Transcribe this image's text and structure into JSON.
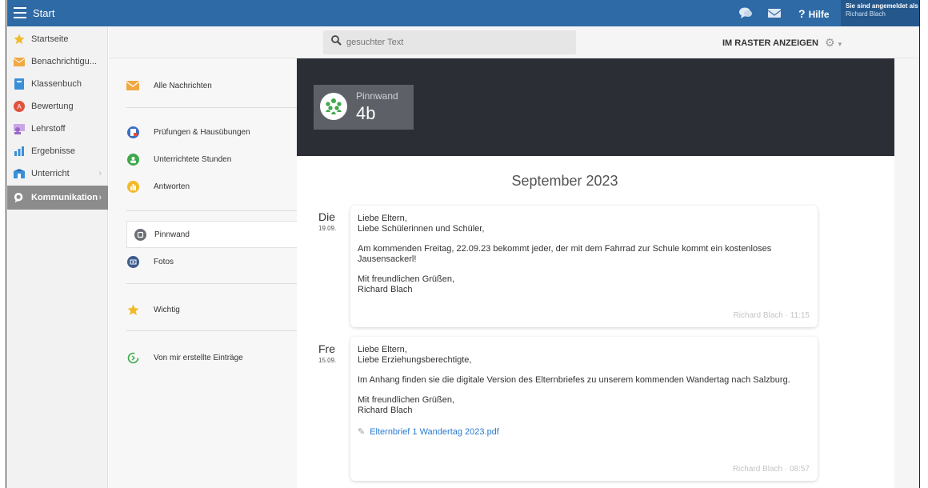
{
  "topbar": {
    "title": "Start",
    "help_label": "Hilfe",
    "login_line1": "Sie sind angemeldet als",
    "login_line2": "Richard Blach"
  },
  "sidebar": {
    "items": [
      {
        "label": "Startseite",
        "icon": "star-icon",
        "color": "#f2b92a"
      },
      {
        "label": "Benachrichtigu...",
        "icon": "mail-icon",
        "color": "#f0a843"
      },
      {
        "label": "Klassenbuch",
        "icon": "book-icon",
        "color": "#3a8fd9"
      },
      {
        "label": "Bewertung",
        "icon": "rating-icon",
        "color": "#e0533d"
      },
      {
        "label": "Lehrstoff",
        "icon": "teacher-icon",
        "color": "#9b67c9"
      },
      {
        "label": "Ergebnisse",
        "icon": "chart-icon",
        "color": "#3a8fd9"
      },
      {
        "label": "Unterricht",
        "icon": "school-icon",
        "color": "#3a8fd9"
      },
      {
        "label": "Kommunikation",
        "icon": "chat-icon",
        "color": "#ffffff"
      }
    ]
  },
  "toolbar": {
    "search_placeholder": "gesuchter Text",
    "raster_label": "IM RASTER ANZEIGEN"
  },
  "subnav": {
    "items": [
      {
        "label": "Alle Nachrichten",
        "icon": "envelope-icon"
      },
      {
        "label": "Prüfungen & Hausübungen",
        "icon": "exam-icon"
      },
      {
        "label": "Unterrichtete Stunden",
        "icon": "lesson-icon"
      },
      {
        "label": "Antworten",
        "icon": "answers-icon"
      },
      {
        "label": "Pinnwand",
        "icon": "pinboard-icon"
      },
      {
        "label": "Fotos",
        "icon": "photos-icon"
      },
      {
        "label": "Wichtig",
        "icon": "star-icon"
      },
      {
        "label": "Von mir erstellte Einträge",
        "icon": "own-entries-icon"
      }
    ]
  },
  "board": {
    "label": "Pinnwand",
    "class_name": "4b"
  },
  "feed": {
    "month": "September 2023",
    "posts": [
      {
        "weekday": "Die",
        "date": "19.09.",
        "lines": [
          "Liebe Eltern,",
          "Liebe Schülerinnen und Schüler,",
          "Am kommenden Freitag, 22.09.23 bekommt jeder, der mit dem Fahrrad zur Schule kommt ein kostenloses Jausensackerl!",
          "Mit freundlichen Grüßen,",
          "Richard Blach"
        ],
        "meta": "Richard Blach · 11:15"
      },
      {
        "weekday": "Fre",
        "date": "15.09.",
        "lines": [
          "Liebe Eltern,",
          "Liebe Erziehungsberechtigte,",
          "Im Anhang finden sie die digitale Version des Elternbriefes zu unserem kommenden Wandertag nach Salzburg.",
          "Mit freundlichen Grüßen,",
          "Richard Blach"
        ],
        "attachment": "Elternbrief 1 Wandertag 2023.pdf",
        "meta": "Richard Blach · 08:57"
      }
    ]
  }
}
